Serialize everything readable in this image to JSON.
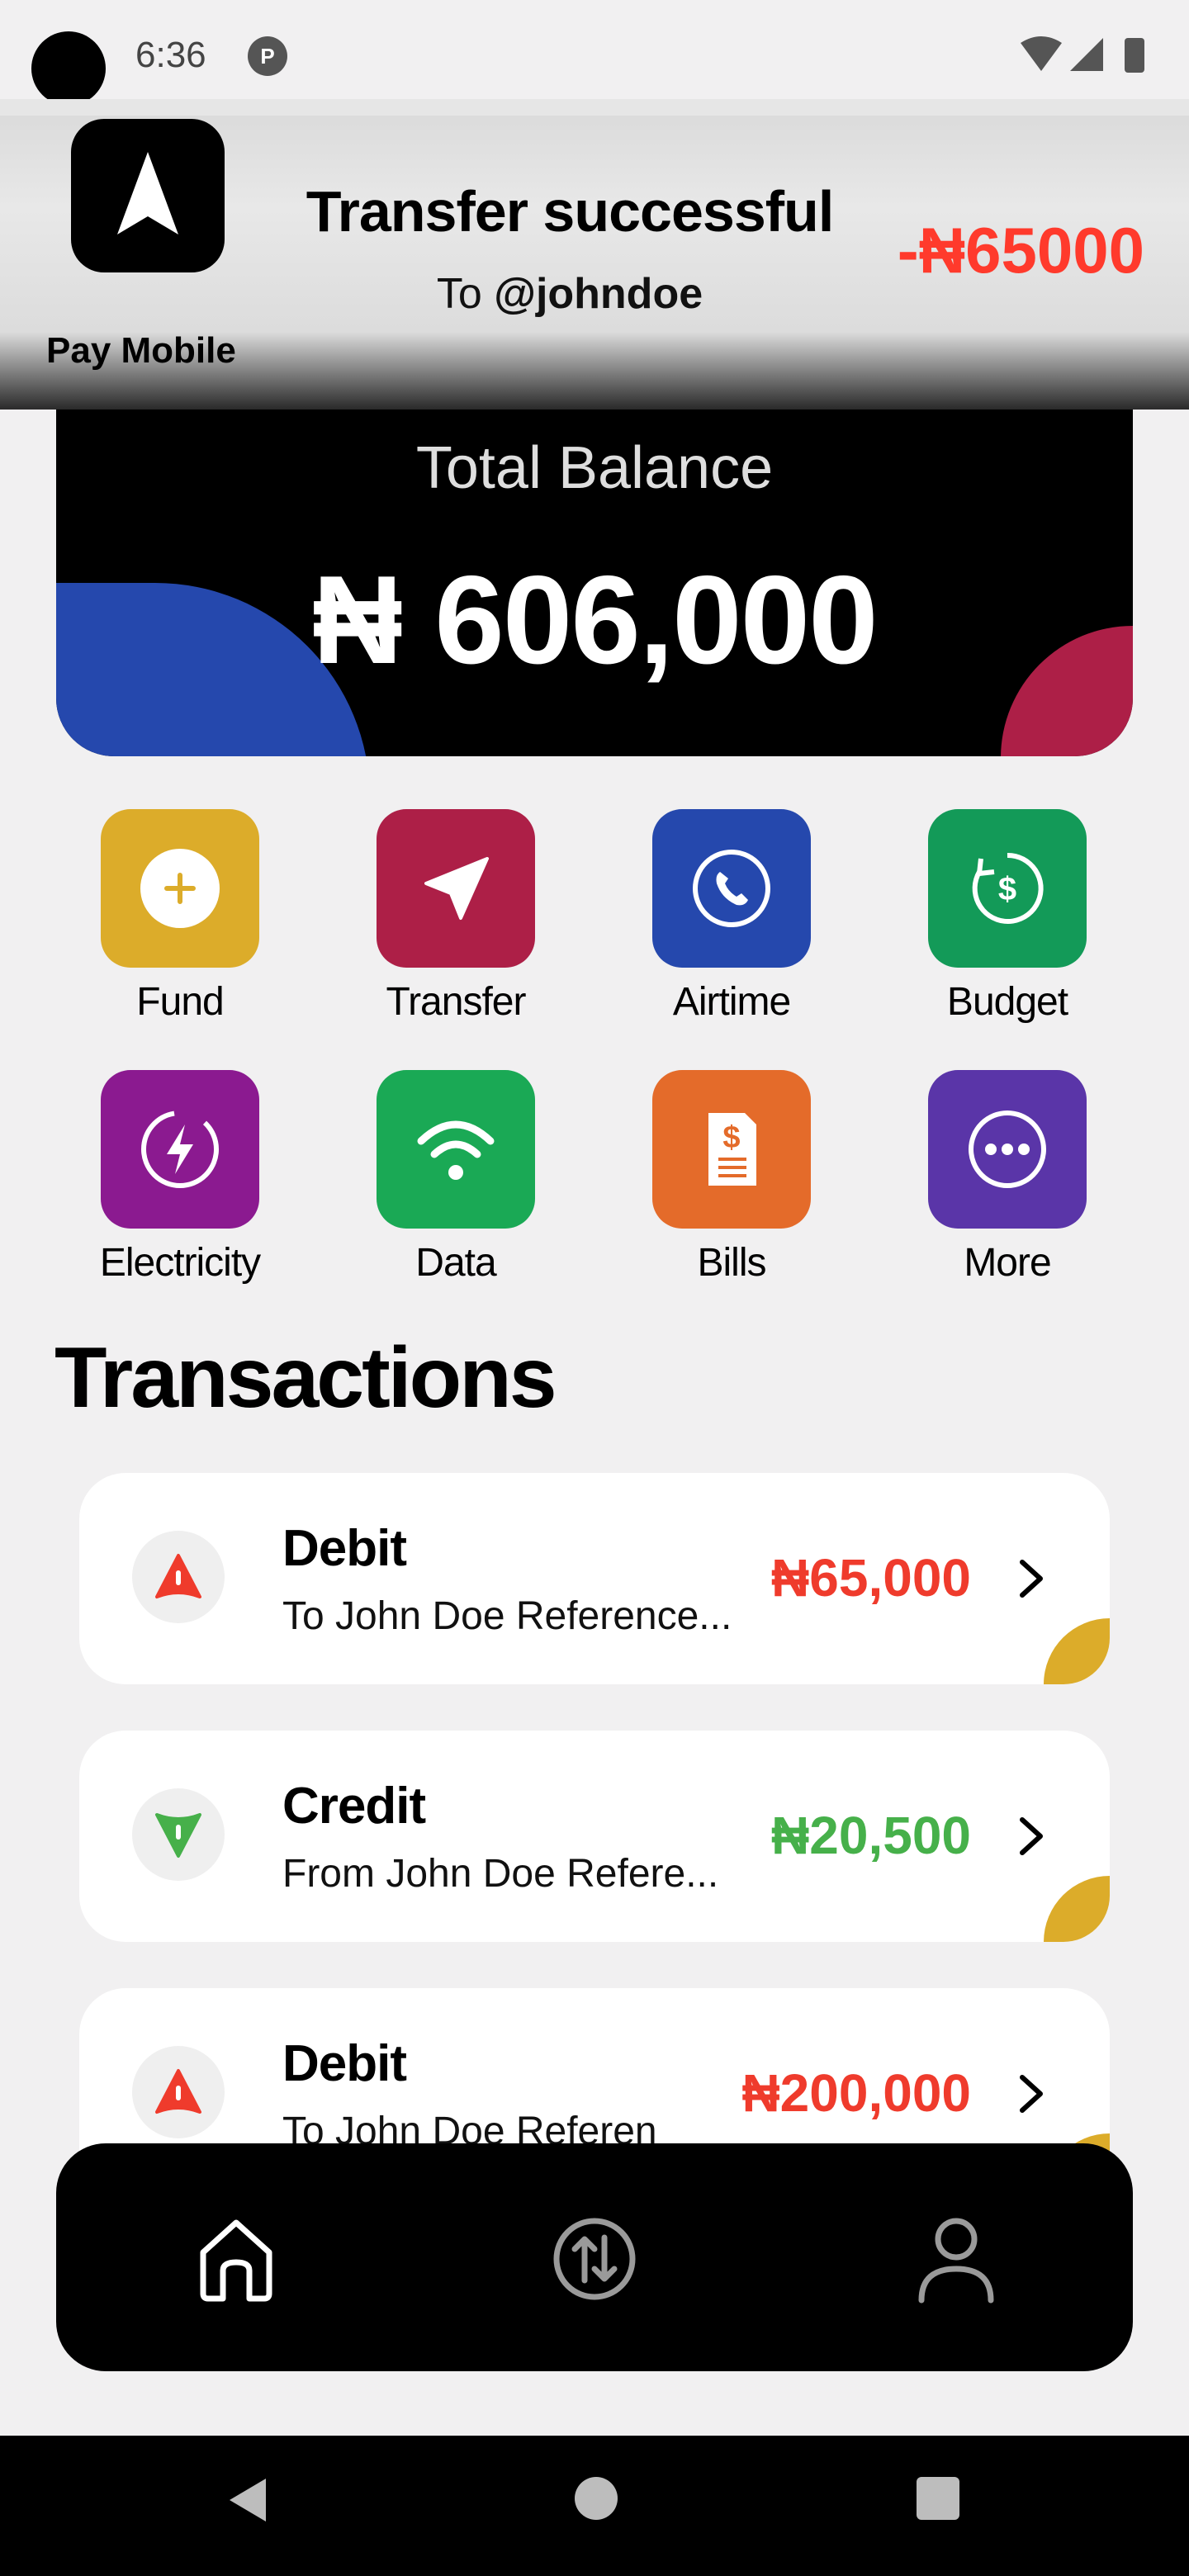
{
  "status_bar": {
    "time": "6:36",
    "notif_glyph": "P"
  },
  "notification": {
    "app_name": "Pay Mobile",
    "title": "Transfer successful",
    "to_prefix": "To ",
    "to_user": "@johndoe",
    "amount": "-₦65000"
  },
  "balance": {
    "label": "Total Balance",
    "value": "₦ 606,000"
  },
  "actions": [
    {
      "label": "Fund",
      "icon": "plus-circle-icon",
      "color": "#dcac2a"
    },
    {
      "label": "Transfer",
      "icon": "send-icon",
      "color": "#ad1f47"
    },
    {
      "label": "Airtime",
      "icon": "phone-icon",
      "color": "#2548ad"
    },
    {
      "label": "Budget",
      "icon": "budget-icon",
      "color": "#139a58"
    },
    {
      "label": "Electricity",
      "icon": "lightning-icon",
      "color": "#8b1a90"
    },
    {
      "label": "Data",
      "icon": "wifi-icon",
      "color": "#1aa955"
    },
    {
      "label": "Bills",
      "icon": "bill-icon",
      "color": "#e46b2a"
    },
    {
      "label": "More",
      "icon": "more-icon",
      "color": "#5a35a8"
    }
  ],
  "transactions": {
    "heading": "Transactions",
    "items": [
      {
        "type": "Debit",
        "description": "To John Doe Reference...",
        "amount": "₦65,000"
      },
      {
        "type": "Credit",
        "description": "From John Doe Refere...",
        "amount": "₦20,500"
      },
      {
        "type": "Debit",
        "description": "To John Doe Referen",
        "amount": "₦200,000"
      }
    ]
  },
  "colors": {
    "debit": "#ef3b2c",
    "credit": "#46b04a",
    "accent_leaf": "#dcac2a"
  },
  "bottom_nav": {
    "items": [
      "home-icon",
      "transfer-arrows-icon",
      "profile-icon"
    ]
  }
}
